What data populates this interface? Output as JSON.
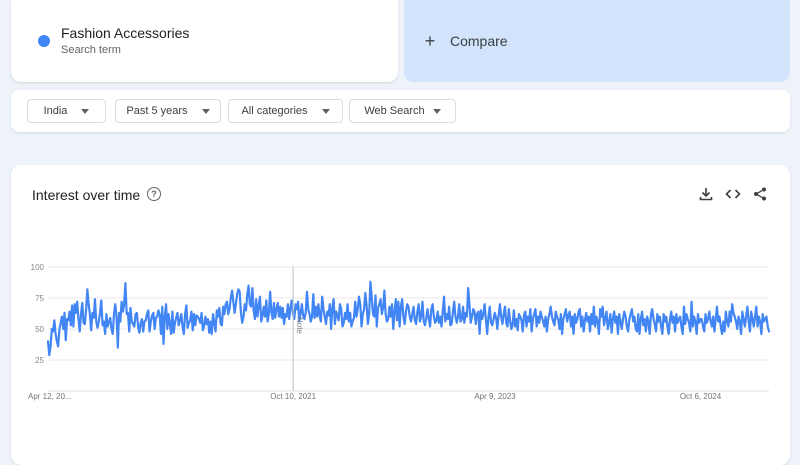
{
  "search_term": {
    "name": "Fashion Accessories",
    "subtitle": "Search term",
    "color": "#4285f4"
  },
  "compare": {
    "label": "Compare",
    "icon": "plus-icon"
  },
  "filters": {
    "region": "India",
    "time_range": "Past 5 years",
    "category": "All categories",
    "search_type": "Web Search"
  },
  "chart_card": {
    "title": "Interest over time",
    "icons": [
      "help-icon",
      "download-icon",
      "embed-icon",
      "share-icon"
    ]
  },
  "chart_data": {
    "type": "line",
    "title": "Interest over time",
    "xlabel": "",
    "ylabel": "",
    "ylim": [
      0,
      100
    ],
    "grid": true,
    "y_ticks": [
      "100",
      "75",
      "50",
      "25"
    ],
    "x_tick_labels": [
      "Apr 12, 20...",
      "Oct 10, 2021",
      "Apr 9, 2023",
      "Oct 6, 2024"
    ],
    "annotation": "Note",
    "series_color": "#4285f4",
    "series": [
      {
        "name": "Fashion Accessories",
        "values": [
          40,
          29,
          36,
          50,
          48,
          57,
          46,
          40,
          36,
          50,
          55,
          60,
          50,
          63,
          41,
          58,
          57,
          64,
          53,
          69,
          52,
          70,
          63,
          72,
          58,
          48,
          62,
          71,
          55,
          54,
          65,
          82,
          70,
          62,
          49,
          63,
          59,
          74,
          56,
          51,
          56,
          63,
          73,
          53,
          56,
          46,
          62,
          52,
          56,
          59,
          50,
          46,
          62,
          70,
          60,
          35,
          63,
          56,
          72,
          64,
          70,
          87,
          62,
          63,
          48,
          67,
          56,
          54,
          52,
          62,
          63,
          52,
          47,
          55,
          58,
          48,
          56,
          57,
          62,
          65,
          48,
          56,
          61,
          63,
          50,
          59,
          60,
          65,
          61,
          46,
          68,
          38,
          60,
          70,
          50,
          62,
          54,
          46,
          64,
          47,
          55,
          59,
          63,
          53,
          57,
          62,
          52,
          46,
          62,
          69,
          51,
          55,
          57,
          64,
          49,
          62,
          53,
          61,
          60,
          58,
          55,
          63,
          49,
          52,
          60,
          54,
          58,
          47,
          56,
          46,
          62,
          55,
          48,
          65,
          60,
          67,
          54,
          53,
          68,
          62,
          70,
          72,
          62,
          66,
          75,
          81,
          72,
          63,
          70,
          78,
          82,
          80,
          63,
          55,
          60,
          70,
          65,
          78,
          85,
          70,
          68,
          83,
          65,
          58,
          74,
          60,
          69,
          76,
          56,
          61,
          68,
          60,
          73,
          56,
          62,
          80,
          64,
          58,
          71,
          59,
          66,
          71,
          60,
          68,
          59,
          67,
          54,
          62,
          60,
          70,
          58,
          67,
          73,
          62,
          58,
          70,
          66,
          72,
          56,
          63,
          70,
          61,
          58,
          63,
          80,
          66,
          62,
          56,
          60,
          78,
          59,
          68,
          60,
          70,
          61,
          56,
          76,
          66,
          60,
          54,
          64,
          61,
          70,
          50,
          67,
          74,
          54,
          64,
          61,
          57,
          70,
          66,
          52,
          55,
          63,
          58,
          70,
          56,
          63,
          52,
          56,
          59,
          72,
          60,
          66,
          76,
          70,
          52,
          62,
          66,
          79,
          69,
          54,
          62,
          88,
          76,
          62,
          60,
          77,
          52,
          67,
          70,
          74,
          62,
          67,
          81,
          62,
          56,
          58,
          68,
          60,
          70,
          50,
          64,
          74,
          57,
          72,
          52,
          68,
          74,
          60,
          54,
          64,
          70,
          68,
          60,
          56,
          62,
          68,
          57,
          54,
          64,
          70,
          56,
          60,
          72,
          56,
          53,
          59,
          66,
          58,
          52,
          66,
          70,
          60,
          55,
          57,
          64,
          55,
          60,
          52,
          64,
          76,
          56,
          62,
          58,
          68,
          53,
          54,
          64,
          72,
          60,
          55,
          60,
          70,
          56,
          58,
          68,
          55,
          63,
          60,
          83,
          70,
          55,
          60,
          66,
          64,
          54,
          62,
          64,
          46,
          65,
          58,
          62,
          70,
          57,
          46,
          60,
          68,
          55,
          53,
          58,
          63,
          59,
          50,
          61,
          70,
          60,
          54,
          62,
          68,
          55,
          52,
          66,
          57,
          50,
          53,
          65,
          52,
          58,
          49,
          62,
          60,
          57,
          48,
          61,
          64,
          52,
          60,
          56,
          66,
          48,
          58,
          62,
          66,
          52,
          60,
          55,
          64,
          60,
          56,
          52,
          60,
          48,
          58,
          62,
          68,
          60,
          56,
          53,
          64,
          60,
          57,
          50,
          62,
          46,
          58,
          62,
          66,
          56,
          61,
          64,
          52,
          60,
          46,
          62,
          55,
          58,
          64,
          66,
          52,
          60,
          48,
          57,
          63,
          56,
          60,
          48,
          62,
          54,
          68,
          52,
          60,
          56,
          46,
          66,
          60,
          68,
          53,
          58,
          64,
          50,
          55,
          62,
          47,
          58,
          64,
          55,
          60,
          46,
          62,
          56,
          50,
          58,
          64,
          60,
          52,
          48,
          58,
          62,
          66,
          56,
          60,
          50,
          48,
          62,
          46,
          58,
          64,
          53,
          58,
          48,
          60,
          56,
          46,
          62,
          66,
          58,
          54,
          48,
          62,
          56,
          60,
          52,
          46,
          62,
          56,
          60,
          52,
          46,
          58,
          64,
          55,
          60,
          48,
          62,
          55,
          58,
          60,
          52,
          46,
          68,
          54,
          62,
          58,
          55,
          48,
          72,
          52,
          60,
          56,
          46,
          62,
          55,
          58,
          58,
          52,
          48,
          62,
          55,
          58,
          64,
          56,
          52,
          60,
          48,
          58,
          68,
          56,
          60,
          52,
          46,
          56,
          48,
          64,
          56,
          52,
          64,
          56,
          70,
          63,
          60,
          56,
          50,
          60,
          56,
          46,
          64,
          58,
          52,
          60,
          68,
          56,
          48,
          64,
          58,
          52,
          60,
          68,
          52,
          60,
          56,
          46,
          62,
          56,
          58,
          60,
          52,
          48
        ]
      }
    ]
  }
}
